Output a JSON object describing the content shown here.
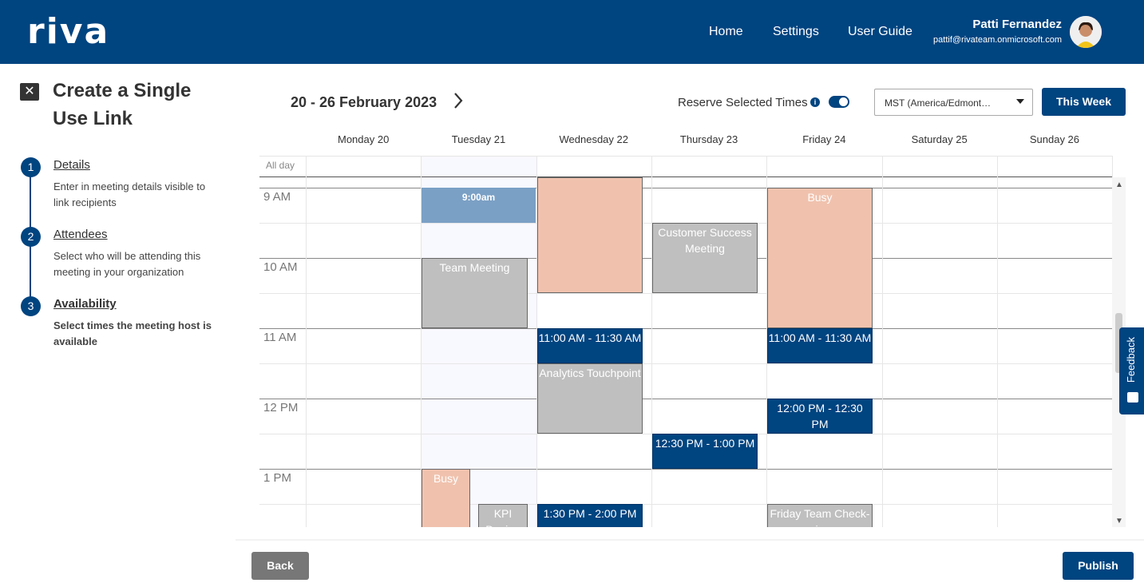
{
  "header": {
    "logo": "riva",
    "nav": [
      "Home",
      "Settings",
      "User Guide"
    ],
    "user_name": "Patti Fernandez",
    "user_email": "pattif@rivateam.onmicrosoft.com"
  },
  "sidebar": {
    "close_icon": "close-icon",
    "title": "Create a Single Use Link",
    "steps": [
      {
        "num": "1",
        "title": "Details",
        "desc": "Enter in meeting details visible to link recipients"
      },
      {
        "num": "2",
        "title": "Attendees",
        "desc": "Select who will be attending this meeting in your organization"
      },
      {
        "num": "3",
        "title": "Availability",
        "desc": "Select times the meeting host is available"
      }
    ]
  },
  "toolbar": {
    "week_label": "20 - 26 February 2023",
    "next_icon": "chevron-right-icon",
    "reserve_label": "Reserve Selected Times",
    "reserve_enabled": true,
    "timezone": "MST (America/Edmont…",
    "this_week": "This Week"
  },
  "calendar": {
    "days": [
      "Monday 20",
      "Tuesday 21",
      "Wednesday 22",
      "Thursday 23",
      "Friday 24",
      "Saturday 25",
      "Sunday 26"
    ],
    "all_day_label": "All day",
    "hours": [
      "9 AM",
      "10 AM",
      "11 AM",
      "12 PM",
      "1 PM"
    ],
    "events": [
      {
        "day": 1,
        "start": 9.0,
        "end": 9.5,
        "kind": "selected",
        "label": "9:00am"
      },
      {
        "day": 1,
        "start": 10.0,
        "end": 11.0,
        "kind": "gray",
        "label": "Team Meeting",
        "width": "narrow"
      },
      {
        "day": 1,
        "start": 13.0,
        "end": 13.85,
        "kind": "busy",
        "label": "Busy",
        "width": "left-half"
      },
      {
        "day": 1,
        "start": 13.5,
        "end": 13.85,
        "kind": "gray",
        "label": "KPI Design",
        "width": "right-half"
      },
      {
        "day": 2,
        "start": 8.85,
        "end": 10.5,
        "kind": "busy",
        "label": ""
      },
      {
        "day": 2,
        "start": 11.0,
        "end": 11.5,
        "kind": "blue",
        "label": "11:00 AM - 11:30 AM"
      },
      {
        "day": 2,
        "start": 11.5,
        "end": 12.5,
        "kind": "gray",
        "label": "Analytics Touchpoint"
      },
      {
        "day": 2,
        "start": 13.5,
        "end": 13.85,
        "kind": "blue",
        "label": "1:30 PM - 2:00 PM"
      },
      {
        "day": 3,
        "start": 9.5,
        "end": 10.5,
        "kind": "gray",
        "label": "Customer Success Meeting"
      },
      {
        "day": 3,
        "start": 12.5,
        "end": 13.0,
        "kind": "blue",
        "label": "12:30 PM - 1:00 PM"
      },
      {
        "day": 4,
        "start": 9.0,
        "end": 11.0,
        "kind": "busy",
        "label": "Busy"
      },
      {
        "day": 4,
        "start": 11.0,
        "end": 11.5,
        "kind": "blue",
        "label": "11:00 AM - 11:30 AM"
      },
      {
        "day": 4,
        "start": 12.0,
        "end": 12.5,
        "kind": "blue",
        "label": "12:00 PM - 12:30 PM"
      },
      {
        "day": 4,
        "start": 13.5,
        "end": 13.85,
        "kind": "gray",
        "label": "Friday Team Check-in"
      }
    ]
  },
  "feedback": {
    "label": "Feedback",
    "icon": "feedback-icon"
  },
  "footer": {
    "back": "Back",
    "publish": "Publish"
  },
  "colors": {
    "brand": "#004480",
    "busy": "#f0c2ae",
    "selected": "#7ba0c5",
    "meeting": "#bfbfbf"
  }
}
